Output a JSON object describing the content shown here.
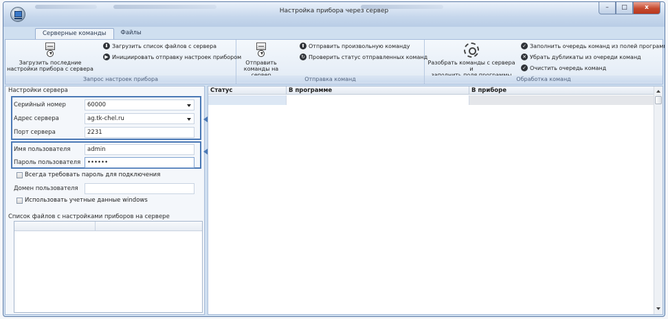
{
  "window": {
    "title": "Настройка прибора через сервер",
    "controls": {
      "minimize": "–",
      "maximize": "□",
      "close": "x"
    }
  },
  "tabs": [
    "Серверные команды",
    "Файлы"
  ],
  "ribbon": {
    "request_group": {
      "label": "Запрос настроек прибора",
      "load_last_line1": "Загрузить последние",
      "load_last_line2": "настройки прибора с сервера",
      "load_file_list": "Загрузить список файлов с сервера",
      "init_send": "Инициировать отправку настроек прибором"
    },
    "send_group": {
      "label": "Отправка команд",
      "send_line1": "Отправить",
      "send_line2": "команды на сервер",
      "send_arbitrary": "Отправить произвольную команду",
      "check_status": "Проверить статус отправленных команд"
    },
    "process_group": {
      "label": "Обработка команд",
      "parse_line1": "Разобрать команды с сервера и",
      "parse_line2": "заполнить поля программы",
      "fill_queue": "Заполнить очередь команд из полей программы",
      "remove_dups": "Убрать дубликаты из очереди команд",
      "clear_queue": "Очистить очередь команд"
    }
  },
  "server_settings": {
    "title": "Настройки сервера",
    "serial_label": "Серийный номер",
    "serial_value": "60000",
    "address_label": "Адрес сервера",
    "address_value": "ag.tk-chel.ru",
    "port_label": "Порт сервера",
    "port_value": "2231",
    "user_label": "Имя пользователя",
    "user_value": "admin",
    "password_label": "Пароль пользователя",
    "password_value": "••••••",
    "always_password": "Всегда требовать пароль для подключения",
    "domain_label": "Домен пользователя",
    "domain_value": "",
    "use_windows": "Использовать учетные данные windows"
  },
  "file_list": {
    "title": "Список файлов с настройками приборов на сервере"
  },
  "grid": {
    "columns": [
      "Статус",
      "В программе",
      "В приборе"
    ]
  },
  "callouts": [
    "1",
    "2"
  ],
  "colors": {
    "accent": "#4a78b5",
    "close": "#c64a2f"
  }
}
